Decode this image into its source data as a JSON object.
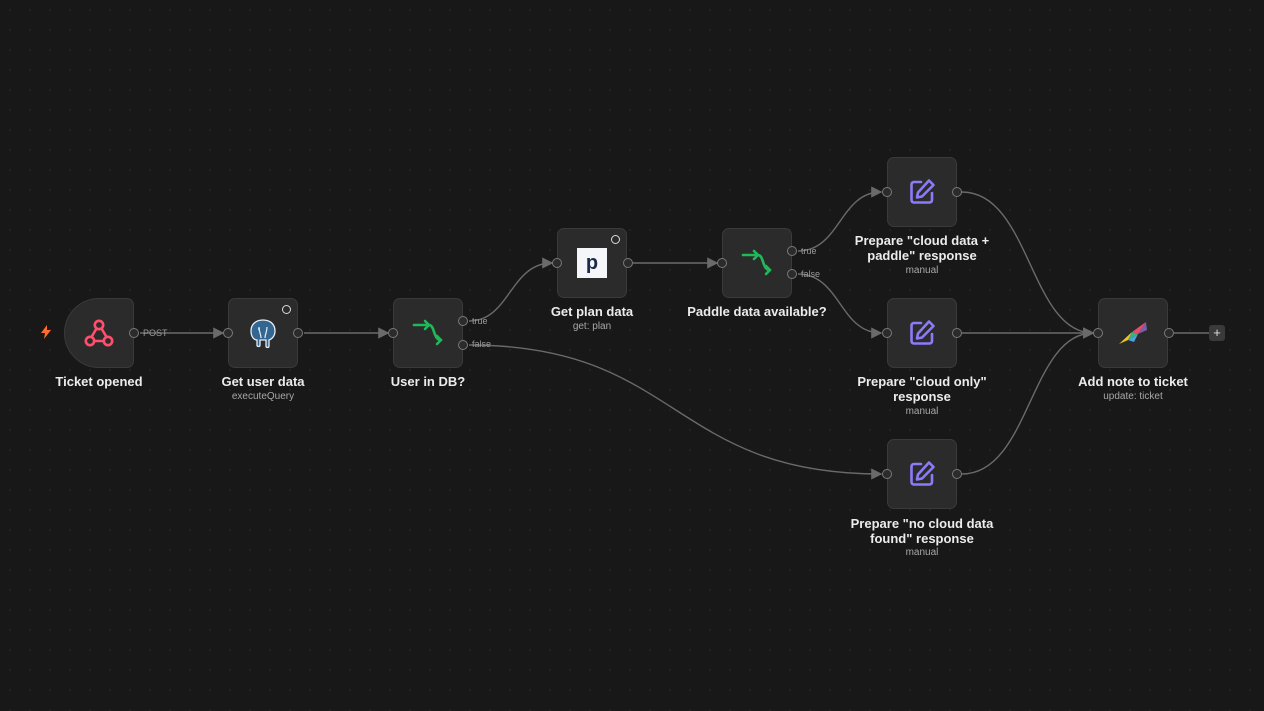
{
  "nodes": {
    "ticket_opened": {
      "label": "Ticket opened",
      "icon": "webhook-icon",
      "edge_label": "POST"
    },
    "get_user_data": {
      "label": "Get user data",
      "subtitle": "executeQuery",
      "icon": "postgres-elephant-icon"
    },
    "user_in_db": {
      "label": "User in DB?",
      "icon": "if-branch-icon",
      "true_label": "true",
      "false_label": "false"
    },
    "get_plan_data": {
      "label": "Get plan data",
      "subtitle": "get: plan",
      "icon": "paddle-logo-icon",
      "logo_letter": "P"
    },
    "paddle_available": {
      "label": "Paddle data available?",
      "icon": "if-branch-icon",
      "true_label": "true",
      "false_label": "false"
    },
    "prep_cloud_paddle": {
      "label": "Prepare \"cloud data + paddle\" response",
      "subtitle": "manual",
      "icon": "edit-pencil-icon"
    },
    "prep_cloud_only": {
      "label": "Prepare \"cloud only\" response",
      "subtitle": "manual",
      "icon": "edit-pencil-icon"
    },
    "prep_no_cloud": {
      "label": "Prepare \"no cloud data found\" response",
      "subtitle": "manual",
      "icon": "edit-pencil-icon"
    },
    "add_note": {
      "label": "Add note to ticket",
      "subtitle": "update: ticket",
      "icon": "bird-logo-icon"
    }
  },
  "add_button": "+",
  "colors": {
    "canvas": "#181818",
    "node_bg": "#2b2b2b",
    "edge": "#6a6a6a",
    "webhook": "#ff4f6d",
    "if_green": "#1fb95a",
    "edit_purple": "#8b7bf7",
    "trigger_bolt": "#ff6d2e"
  }
}
